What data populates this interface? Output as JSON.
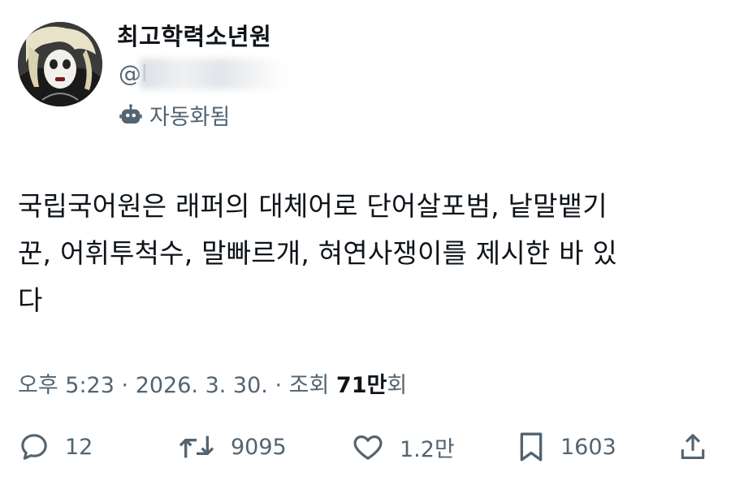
{
  "profile": {
    "display_name": "최고학력소년원",
    "handle": "@l",
    "automated_label": "자동화됨",
    "avatar_icon": "avatar-icon"
  },
  "tweet": {
    "lines": [
      "국립국어원은 래퍼의 대체어로 단어살포범, 낱말뱉기",
      "꾼, 어휘투척수, 말빠르개, 혀연사쟁이를 제시한 바 있",
      "다"
    ]
  },
  "meta": {
    "time": "오후 5:23",
    "sep1": "·",
    "date": "2026. 3. 30.",
    "sep2": "·",
    "views_prefix": "조회",
    "views_value": "71만",
    "views_suffix": "회"
  },
  "actions": {
    "reply_count": "12",
    "retweet_count": "9095",
    "like_count": "1.2만",
    "bookmark_count": "1603"
  },
  "colors": {
    "text": "#0f1419",
    "secondary": "#536471",
    "background": "#ffffff"
  }
}
